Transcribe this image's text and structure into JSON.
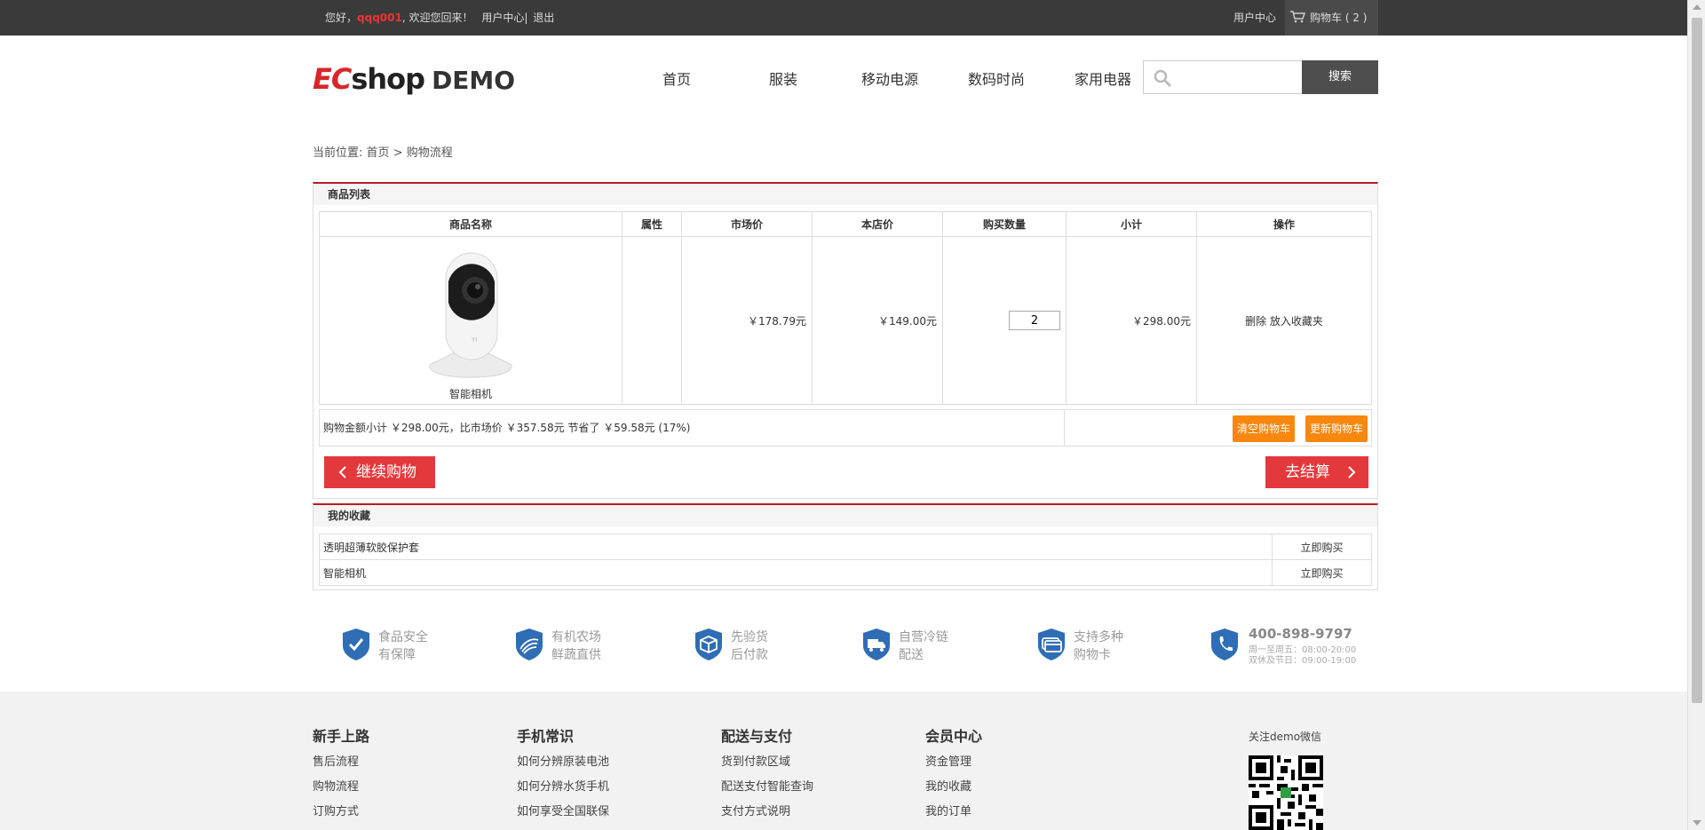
{
  "topbar": {
    "greeting_prefix": "您好，",
    "username": "qqq001",
    "greeting_suffix": ", 欢迎您回来！",
    "user_center_link": "用户中心",
    "separator": "|",
    "logout": "退出",
    "user_center": "用户中心",
    "cart_label": "购物车 ( 2 )"
  },
  "header": {
    "logo_ec": "EC",
    "logo_shop": "shop",
    "logo_demo": "DEMO",
    "nav": [
      "首页",
      "服装",
      "移动电源",
      "数码时尚",
      "家用电器"
    ],
    "search_placeholder": "",
    "search_button": "搜索"
  },
  "breadcrumb": {
    "label": "当前位置:",
    "home": "首页",
    "sep": ">",
    "current": "购物流程"
  },
  "cart": {
    "title": "商品列表",
    "columns": [
      "商品名称",
      "属性",
      "市场价",
      "本店价",
      "购买数量",
      "小计",
      "操作"
    ],
    "item": {
      "name": "智能相机",
      "attributes": "",
      "market_price": "￥178.79元",
      "shop_price": "￥149.00元",
      "quantity": "2",
      "subtotal": "￥298.00元",
      "delete": "删除",
      "favorite": "放入收藏夹"
    },
    "summary": "购物金额小计 ￥298.00元，比市场价 ￥357.58元 节省了 ￥59.58元 (17%)",
    "clear_button": "清空购物车",
    "update_button": "更新购物车",
    "continue_button": "继续购物",
    "checkout_button": "去结算"
  },
  "favorites": {
    "title": "我的收藏",
    "items": [
      {
        "name": "透明超薄软胶保护套",
        "action": "立即购买"
      },
      {
        "name": "智能相机",
        "action": "立即购买"
      }
    ]
  },
  "features": [
    {
      "icon": "shield-check-icon",
      "line1": "食品安全",
      "line2": "有保障"
    },
    {
      "icon": "shield-farm-icon",
      "line1": "有机农场",
      "line2": "鲜蔬直供"
    },
    {
      "icon": "shield-box-icon",
      "line1": "先验货",
      "line2": "后付款"
    },
    {
      "icon": "shield-truck-icon",
      "line1": "自营冷链",
      "line2": "配送"
    },
    {
      "icon": "shield-card-icon",
      "line1": "支持多种",
      "line2": "购物卡"
    }
  ],
  "phone": {
    "number": "400-898-9797",
    "hours1": "周一至周五：08:00-20:00",
    "hours2": "双休及节日：09:00-19:00"
  },
  "footer": {
    "columns": [
      {
        "title": "新手上路",
        "links": [
          "售后流程",
          "购物流程",
          "订购方式"
        ]
      },
      {
        "title": "手机常识",
        "links": [
          "如何分辨原装电池",
          "如何分辨水货手机",
          "如何享受全国联保"
        ]
      },
      {
        "title": "配送与支付",
        "links": [
          "货到付款区域",
          "配送支付智能查询",
          "支付方式说明"
        ]
      },
      {
        "title": "会员中心",
        "links": [
          "资金管理",
          "我的收藏",
          "我的订单"
        ]
      }
    ],
    "qr_label": "关注demo微信"
  },
  "colors": {
    "topbar_bg": "#3a3a3a",
    "accent_red": "#e4393c",
    "panel_border_red": "#b81c22",
    "button_orange": "#f7870f",
    "feature_blue": "#2f6db5"
  }
}
